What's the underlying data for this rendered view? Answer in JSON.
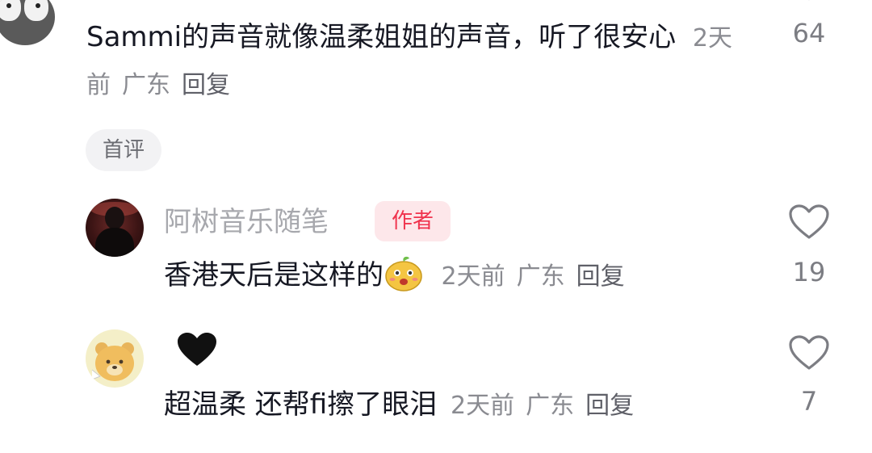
{
  "top_comment": {
    "text": "Sammi的声音就像温柔姐姐的声音，听了很安心",
    "time": "2天前",
    "location": "广东",
    "reply_label": "回复",
    "like_count": "64"
  },
  "tag_chip": "首评",
  "replies": [
    {
      "username": "阿树音乐随笔",
      "badge": "作者",
      "text": "香港天后是这样的",
      "time": "2天前",
      "location": "广东",
      "reply_label": "回复",
      "like_count": "19",
      "emoji": "mango-face-emoji"
    },
    {
      "username_icon": "black-heart-icon",
      "text": "超温柔 还帮fi擦了眼泪",
      "time": "2天前",
      "location": "广东",
      "reply_label": "回复",
      "like_count": "7"
    }
  ],
  "colors": {
    "text_primary": "#161823",
    "text_meta": "#8a8b91",
    "username": "#a7a8ad",
    "badge_bg": "#fde7ea",
    "badge_text": "#f0334d",
    "chip_bg": "#f2f2f4"
  }
}
